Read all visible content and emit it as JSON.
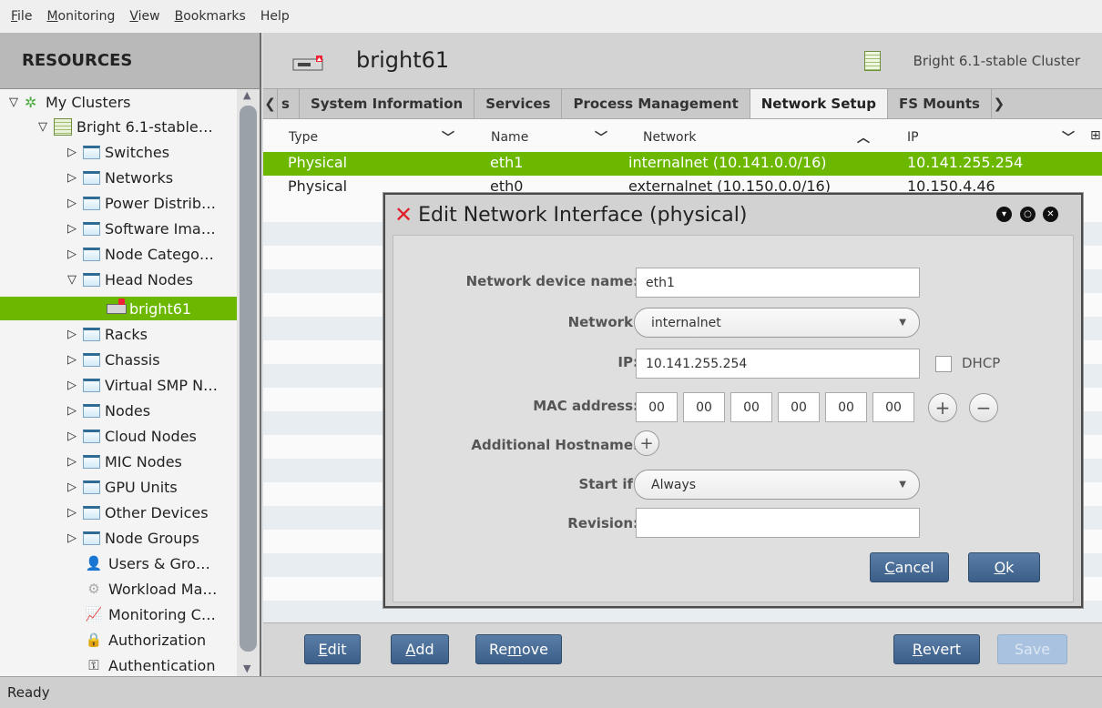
{
  "menu": [
    {
      "label": "File"
    },
    {
      "label": "Monitoring"
    },
    {
      "label": "View"
    },
    {
      "label": "Bookmarks"
    },
    {
      "label": "Help"
    }
  ],
  "left_panel": {
    "title": "RESOURCES",
    "tree": [
      {
        "label": "My Clusters"
      },
      {
        "label": "Bright 6.1-stable…"
      },
      {
        "label": "Switches"
      },
      {
        "label": "Networks"
      },
      {
        "label": "Power Distrib…"
      },
      {
        "label": "Software Ima…"
      },
      {
        "label": "Node Catego…"
      },
      {
        "label": "Head Nodes"
      },
      {
        "label": "bright61"
      },
      {
        "label": "Racks"
      },
      {
        "label": "Chassis"
      },
      {
        "label": "Virtual SMP N…"
      },
      {
        "label": "Nodes"
      },
      {
        "label": "Cloud Nodes"
      },
      {
        "label": "MIC Nodes"
      },
      {
        "label": "GPU Units"
      },
      {
        "label": "Other Devices"
      },
      {
        "label": "Node Groups"
      },
      {
        "label": "Users & Gro…"
      },
      {
        "label": "Workload Ma…"
      },
      {
        "label": "Monitoring C…"
      },
      {
        "label": "Authorization"
      },
      {
        "label": "Authentication"
      }
    ]
  },
  "header": {
    "node_name": "bright61",
    "cluster_label": "Bright 6.1-stable Cluster"
  },
  "tabs": [
    {
      "label": "s"
    },
    {
      "label": "System Information"
    },
    {
      "label": "Services"
    },
    {
      "label": "Process Management"
    },
    {
      "label": "Network Setup"
    },
    {
      "label": "FS Mounts"
    }
  ],
  "grid": {
    "columns": [
      "Type",
      "Name",
      "Network",
      "IP"
    ],
    "rows": [
      {
        "type": "Physical",
        "name": "eth1",
        "network": "internalnet (10.141.0.0/16)",
        "ip": "10.141.255.254"
      },
      {
        "type": "Physical",
        "name": "eth0",
        "network": "externalnet (10.150.0.0/16)",
        "ip": "10.150.4.46"
      }
    ]
  },
  "buttons": {
    "edit": {
      "pre": "",
      "ul": "E",
      "post": "dit"
    },
    "add": {
      "pre": "",
      "ul": "A",
      "post": "dd"
    },
    "remove": {
      "pre": "Re",
      "ul": "m",
      "post": "ove"
    },
    "revert": {
      "pre": "",
      "ul": "R",
      "post": "evert"
    },
    "save": {
      "label": "Save"
    }
  },
  "status": "Ready",
  "dialog": {
    "title": "Edit Network Interface (physical)",
    "labels": {
      "device_name": "Network device name:",
      "network": "Network:",
      "ip": "IP:",
      "mac": "MAC address:",
      "hostname": "Additional Hostname:",
      "start_if": "Start if:",
      "revision": "Revision:"
    },
    "values": {
      "device_name": "eth1",
      "network": "internalnet",
      "ip": "10.141.255.254",
      "dhcp_label": "DHCP",
      "mac": [
        "00",
        "00",
        "00",
        "00",
        "00",
        "00"
      ],
      "start_if": "Always",
      "revision": ""
    },
    "cancel": {
      "ul": "C",
      "post": "ancel"
    },
    "ok": {
      "ul": "O",
      "post": "k"
    }
  }
}
